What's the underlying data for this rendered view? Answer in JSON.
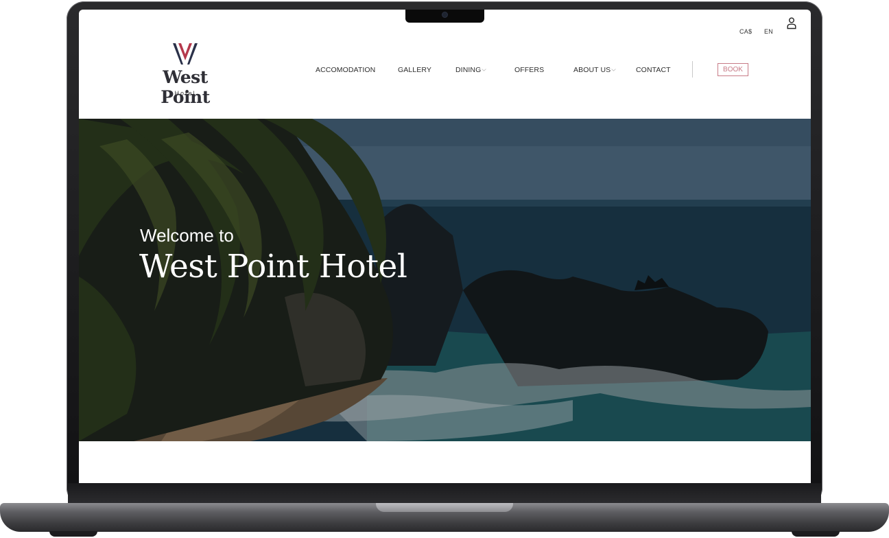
{
  "header": {
    "currency": "CA$",
    "language": "EN",
    "brand": {
      "name": "West Point",
      "sub": "Hotel"
    },
    "nav": [
      {
        "label": "ACCOMODATION"
      },
      {
        "label": "GALLERY"
      },
      {
        "label": "DINING"
      },
      {
        "label": "OFFERS"
      },
      {
        "label": "ABOUT US"
      },
      {
        "label": "CONTACT"
      }
    ],
    "book_label": "BOOK"
  },
  "hero": {
    "welcome": "Welcome to",
    "title": "West Point Hotel"
  },
  "colors": {
    "accent": "#c77a86",
    "brand_dark": "#2f2f36",
    "logo_red": "#b5394c",
    "logo_navy": "#2b3149"
  },
  "icons": [
    "user-icon",
    "chevron-down-icon",
    "logo-mark"
  ]
}
